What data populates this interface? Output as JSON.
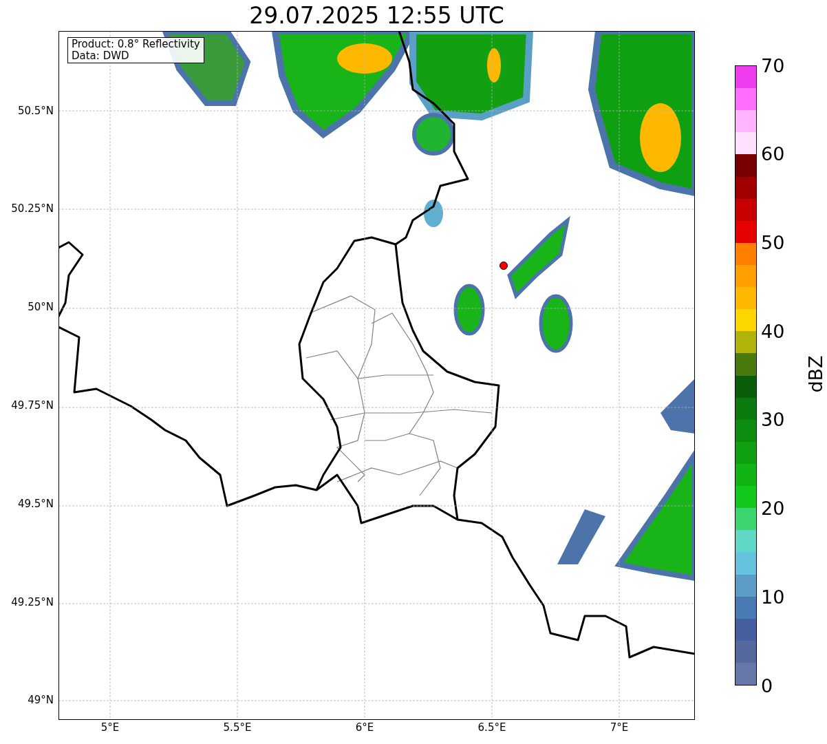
{
  "title": "29.07.2025 12:55 UTC",
  "info_box": [
    "Product: 0.8° Reflectivity",
    "Data: DWD"
  ],
  "map": {
    "lat_ticks": [
      "50.5°N",
      "50.25°N",
      "50°N",
      "49.75°N",
      "49.5°N",
      "49.25°N",
      "49°N"
    ],
    "lon_ticks": [
      "5°E",
      "5.5°E",
      "6°E",
      "6.5°E",
      "7°E"
    ]
  },
  "colorbar": {
    "label": "dBZ",
    "ticks": [
      "70",
      "60",
      "50",
      "40",
      "30",
      "20",
      "10",
      "0"
    ],
    "bands": [
      {
        "color": "#ee3cee"
      },
      {
        "color": "#ff6eff"
      },
      {
        "color": "#ffb4ff"
      },
      {
        "color": "#ffe0ff"
      },
      {
        "color": "#780000"
      },
      {
        "color": "#a00000"
      },
      {
        "color": "#c80000"
      },
      {
        "color": "#e60000"
      },
      {
        "color": "#ff8000"
      },
      {
        "color": "#ffa000"
      },
      {
        "color": "#ffb800"
      },
      {
        "color": "#ffd700"
      },
      {
        "color": "#b0b40a"
      },
      {
        "color": "#4a7a0e"
      },
      {
        "color": "#0a5e0a"
      },
      {
        "color": "#0c7a0e"
      },
      {
        "color": "#0e8c10"
      },
      {
        "color": "#0fa012"
      },
      {
        "color": "#10b414"
      },
      {
        "color": "#12c81a"
      },
      {
        "color": "#3cd66e"
      },
      {
        "color": "#5fd9c6"
      },
      {
        "color": "#66c3de"
      },
      {
        "color": "#5a9cc6"
      },
      {
        "color": "#4a7ab3"
      },
      {
        "color": "#445ea0"
      },
      {
        "color": "#56699e"
      },
      {
        "color": "#6677a8"
      }
    ]
  }
}
